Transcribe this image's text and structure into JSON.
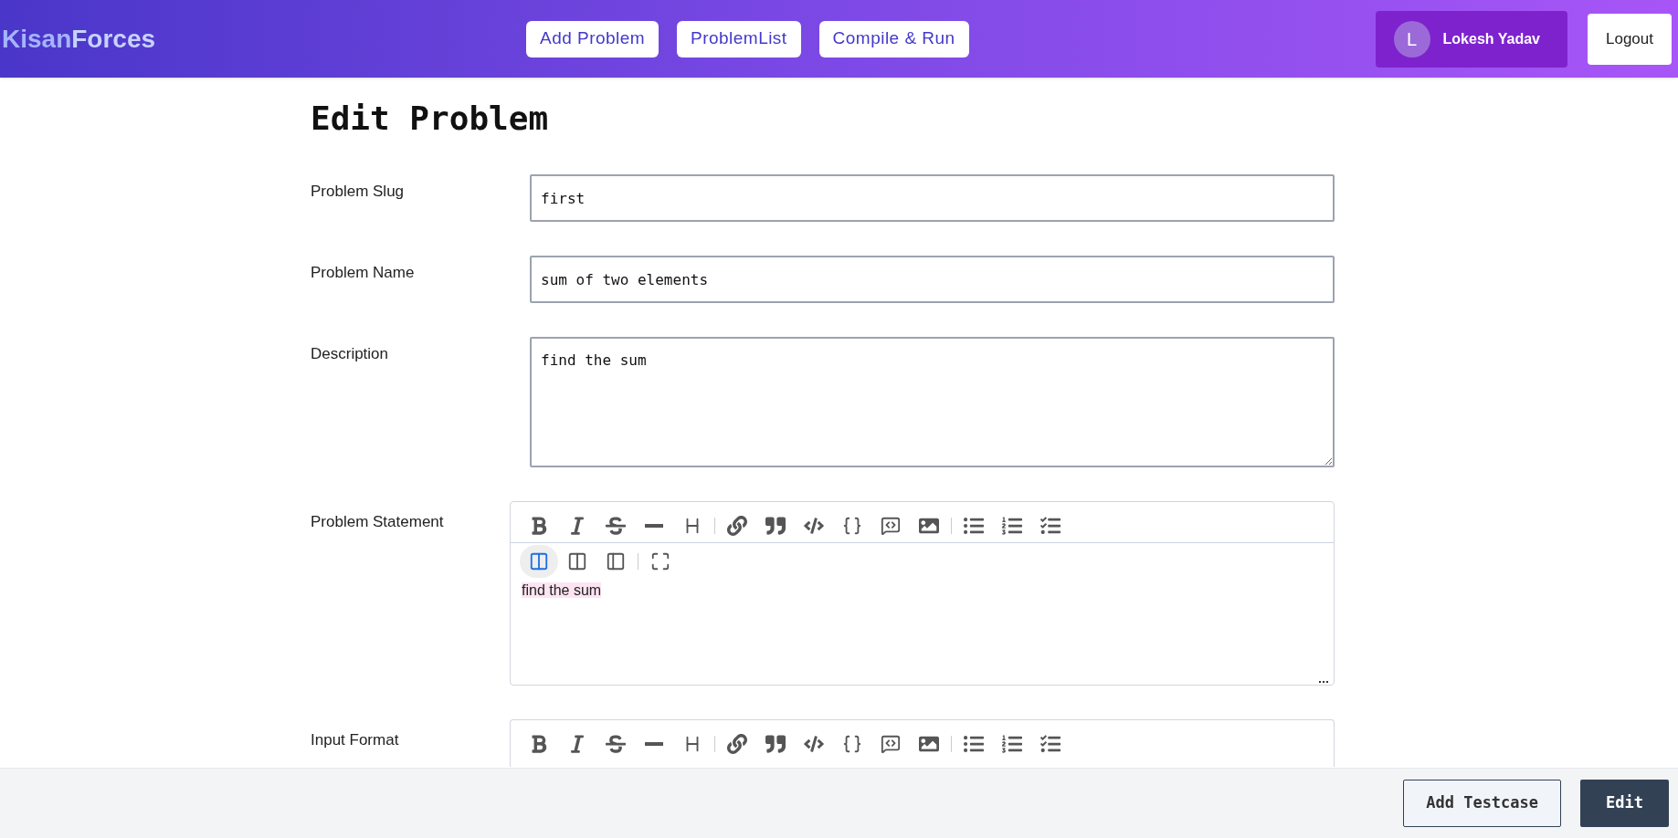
{
  "header": {
    "logo_first": "Kisan",
    "logo_second": "Forces",
    "nav": [
      "Add Problem",
      "ProblemList",
      "Compile & Run"
    ],
    "user": {
      "initial": "L",
      "name": "Lokesh Yadav"
    },
    "logout": "Logout"
  },
  "title": "Edit Problem",
  "fields": [
    {
      "label": "Problem Slug",
      "value": "first",
      "kind": "input"
    },
    {
      "label": "Problem Name",
      "value": "sum of two elements",
      "kind": "input"
    },
    {
      "label": "Description",
      "value": "find the sum",
      "kind": "textarea"
    }
  ],
  "editors": [
    {
      "label": "Problem Statement",
      "content": "find the sum",
      "split_view_on": true,
      "kind": "full"
    },
    {
      "label": "Input Format",
      "kind": "cut"
    }
  ],
  "footer": {
    "buttons": [
      {
        "label": "Add Testcase",
        "kind": "secondary"
      },
      {
        "label": "Edit",
        "kind": "primary"
      }
    ]
  }
}
